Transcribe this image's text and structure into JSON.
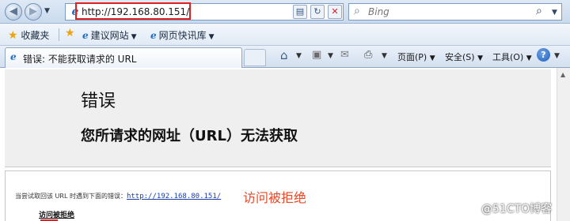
{
  "address_bar": {
    "url": "http://192.168.80.151/",
    "search_placeholder": "Bing"
  },
  "favorites_bar": {
    "favorites_label": "收藏夹",
    "items": [
      {
        "label": "建议网站"
      },
      {
        "label": "网页快讯库"
      }
    ]
  },
  "tab": {
    "title": "错误: 不能获取请求的 URL"
  },
  "command_bar": {
    "page_label": "页面(P)",
    "safety_label": "安全(S)",
    "tools_label": "工具(O)"
  },
  "page": {
    "title": "错误",
    "subtitle": "您所请求的网址（URL）无法获取",
    "detail_prefix": "当尝试取回该 URL 时遇到下面的错误：",
    "detail_link": "http://192.168.80.151/",
    "access_denied": "访问被拒绝",
    "annotation": "访问被拒绝"
  },
  "watermark": "@51CTO博客",
  "colors": {
    "annotation": "#e64a2a",
    "highlight_box": "#e02020",
    "link": "#1a3ea8"
  }
}
